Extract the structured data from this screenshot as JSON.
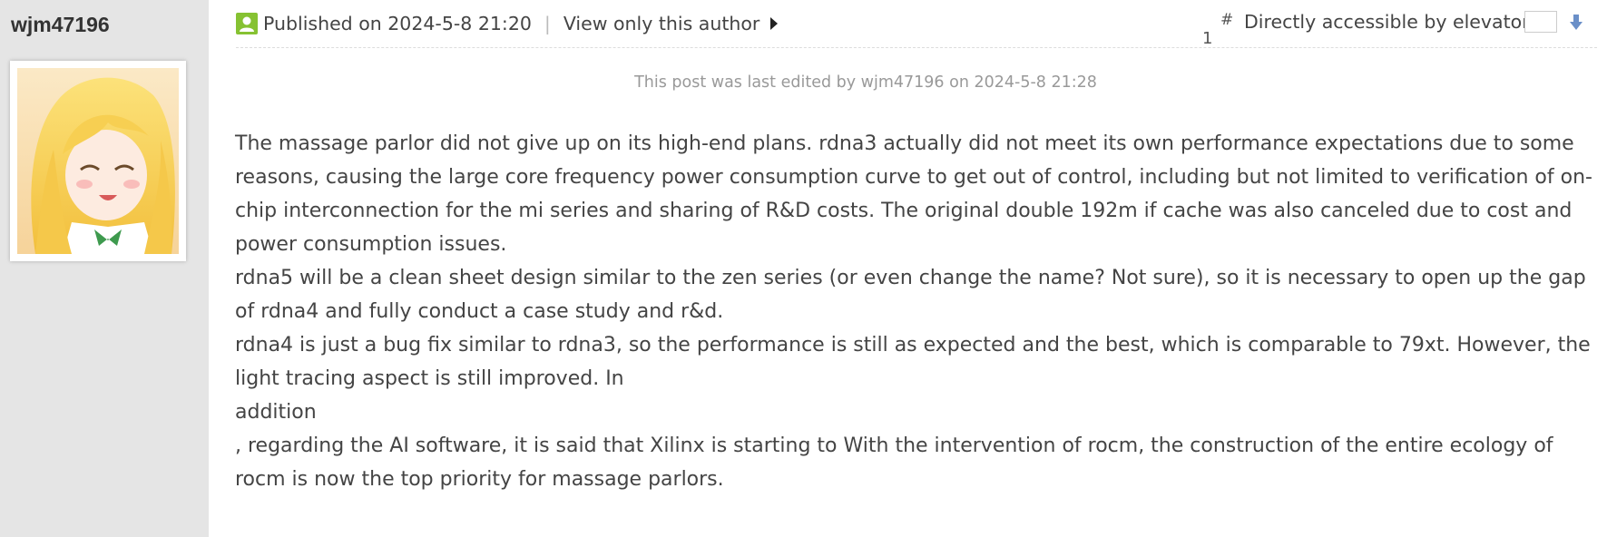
{
  "author": {
    "name": "wjm47196",
    "avatar": "anime-character-avatar"
  },
  "header": {
    "published": "Published on 2024-5-8 21:20",
    "separator": "|",
    "view_only_author": "View only this author",
    "floor_number": "1",
    "floor_symbol": "#",
    "elevator_label": "Directly accessible by elevator",
    "elevator_value": "",
    "icons": {
      "author": "user-icon",
      "view_only": "play-icon",
      "go": "arrow-down-icon"
    },
    "colors": {
      "user_icon": "#86c232",
      "go_arrow": "#6a8fc8"
    }
  },
  "edit_notice": "This post was last edited by wjm47196 on 2024-5-8 21:28",
  "body": {
    "paragraphs": [
      "The massage parlor did not give up on its high-end plans. rdna3 actually did not meet its own performance expectations due to some reasons, causing the large core frequency power consumption curve to get out of control, including but not limited to verification of on-chip interconnection for the mi series and sharing of R&D costs. The original double 192m if cache was also canceled due to cost and power consumption issues.",
      "rdna5 will be a clean sheet design similar to the zen series (or even change the name? Not sure), so it is necessary to open up the gap of rdna4 and fully conduct a case study and r&d.",
      "rdna4 is just a bug fix similar to rdna3, so the performance is still as expected and the best, which is comparable to 79xt. However, the light tracing aspect is still improved. In",
      "addition",
      ", regarding the AI software, it is said that Xilinx is starting to With the intervention of rocm, the construction of the entire ecology of rocm is now the top priority for massage parlors."
    ]
  }
}
